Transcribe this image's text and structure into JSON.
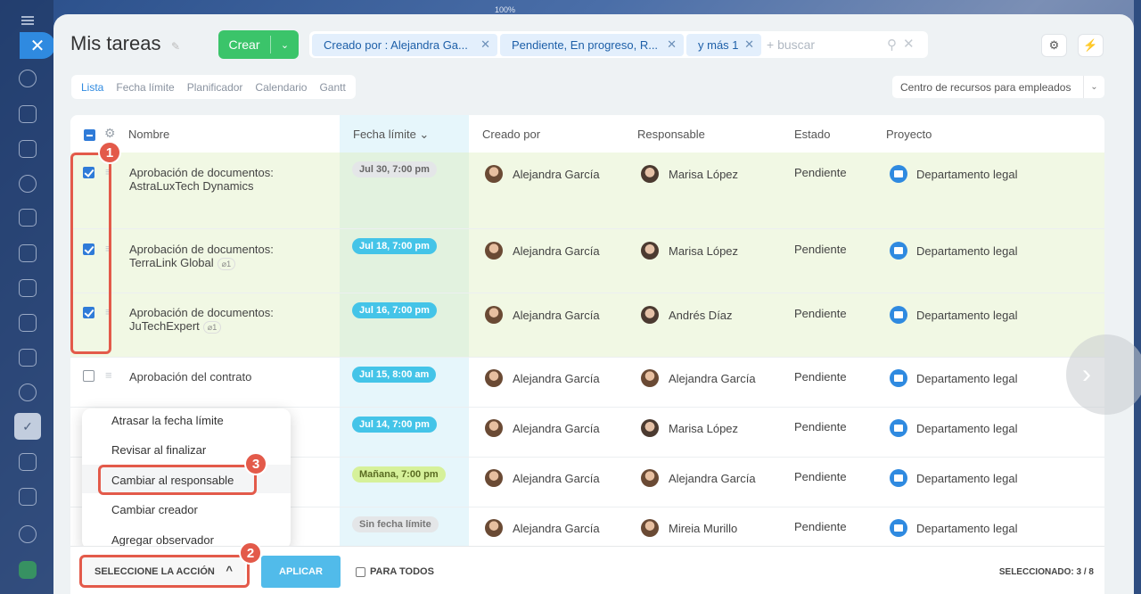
{
  "zoom": "100%",
  "page": {
    "title": "Mis tareas"
  },
  "toolbar": {
    "create_label": "Crear"
  },
  "filters": {
    "chips": [
      "Creado por : Alejandra Ga...",
      "Pendiente, En progreso, R...",
      "y más 1"
    ],
    "search_placeholder": "+ buscar"
  },
  "views": [
    "Lista",
    "Fecha límite",
    "Planificador",
    "Calendario",
    "Gantt"
  ],
  "resource_select": "Centro de recursos para empleados",
  "columns": {
    "name": "Nombre",
    "deadline": "Fecha límite",
    "created_by": "Creado por",
    "responsible": "Responsable",
    "status": "Estado",
    "project": "Proyecto"
  },
  "rows": [
    {
      "name": "Aprobación de documentos: AstraLuxTech Dynamics",
      "deadline": "Jul 30, 7:00 pm",
      "deadline_color": "#e4e6e8",
      "deadline_text_color": "#666666",
      "created_by": "Alejandra García",
      "responsible": "Marisa López",
      "status": "Pendiente",
      "project": "Departamento legal",
      "checked": true,
      "attachments": ""
    },
    {
      "name": "Aprobación de documentos: TerraLink Global",
      "deadline": "Jul 18, 7:00 pm",
      "deadline_color": "#44c4e8",
      "deadline_text_color": "#ffffff",
      "created_by": "Alejandra García",
      "responsible": "Marisa López",
      "status": "Pendiente",
      "project": "Departamento legal",
      "checked": true,
      "attachments": "1"
    },
    {
      "name": "Aprobación de documentos: JuTechExpert",
      "deadline": "Jul 16, 7:00 pm",
      "deadline_color": "#44c4e8",
      "deadline_text_color": "#ffffff",
      "created_by": "Alejandra García",
      "responsible": "Andrés Díaz",
      "status": "Pendiente",
      "project": "Departamento legal",
      "checked": true,
      "attachments": "1"
    },
    {
      "name": "Aprobación del contrato",
      "deadline": "Jul 15, 8:00 am",
      "deadline_color": "#44c4e8",
      "deadline_text_color": "#ffffff",
      "created_by": "Alejandra García",
      "responsible": "Alejandra García",
      "status": "Pendiente",
      "project": "Departamento legal",
      "checked": false,
      "attachments": ""
    },
    {
      "name": "",
      "deadline": "Jul 14, 7:00 pm",
      "deadline_color": "#44c4e8",
      "deadline_text_color": "#ffffff",
      "created_by": "Alejandra García",
      "responsible": "Marisa López",
      "status": "Pendiente",
      "project": "Departamento legal",
      "checked": false,
      "attachments": ""
    },
    {
      "name": "",
      "deadline": "Mañana, 7:00 pm",
      "deadline_color": "#d6f19a",
      "deadline_text_color": "#5a6b22",
      "created_by": "Alejandra García",
      "responsible": "Alejandra García",
      "status": "Pendiente",
      "project": "Departamento legal",
      "checked": false,
      "attachments": ""
    },
    {
      "name": "",
      "deadline": "Sin fecha límite",
      "deadline_color": "#e4e6e8",
      "deadline_text_color": "#777777",
      "created_by": "Alejandra García",
      "responsible": "Mireia Murillo",
      "status": "Pendiente",
      "project": "Departamento legal",
      "checked": false,
      "attachments": ""
    }
  ],
  "action_menu": [
    "Atrasar la fecha límite",
    "Revisar al finalizar",
    "Cambiar al responsable",
    "Cambiar creador",
    "Agregar observador"
  ],
  "bottom_bar": {
    "action_select": "SELECCIONE LA ACCIÓN",
    "apply": "APLICAR",
    "for_all": "PARA TODOS",
    "selected": "SELECCIONADO: 3 / 8"
  },
  "annotations": [
    "1",
    "2",
    "3"
  ]
}
